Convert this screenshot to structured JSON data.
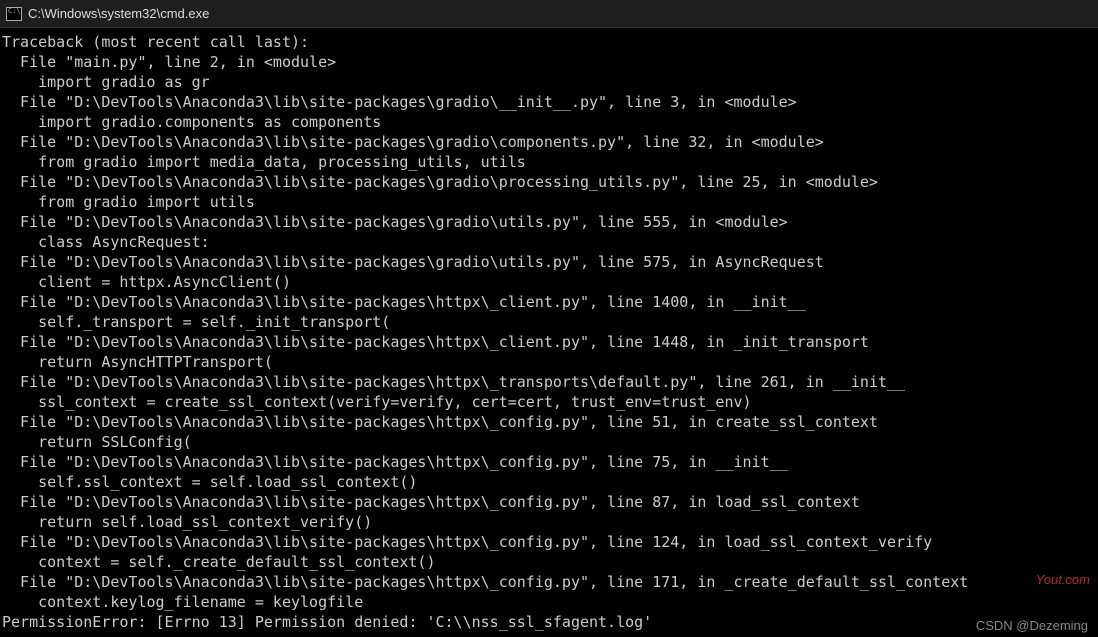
{
  "window": {
    "title": "C:\\Windows\\system32\\cmd.exe"
  },
  "terminal": {
    "lines": [
      "Traceback (most recent call last):",
      "  File \"main.py\", line 2, in <module>",
      "    import gradio as gr",
      "  File \"D:\\DevTools\\Anaconda3\\lib\\site-packages\\gradio\\__init__.py\", line 3, in <module>",
      "    import gradio.components as components",
      "  File \"D:\\DevTools\\Anaconda3\\lib\\site-packages\\gradio\\components.py\", line 32, in <module>",
      "    from gradio import media_data, processing_utils, utils",
      "  File \"D:\\DevTools\\Anaconda3\\lib\\site-packages\\gradio\\processing_utils.py\", line 25, in <module>",
      "    from gradio import utils",
      "  File \"D:\\DevTools\\Anaconda3\\lib\\site-packages\\gradio\\utils.py\", line 555, in <module>",
      "    class AsyncRequest:",
      "  File \"D:\\DevTools\\Anaconda3\\lib\\site-packages\\gradio\\utils.py\", line 575, in AsyncRequest",
      "    client = httpx.AsyncClient()",
      "  File \"D:\\DevTools\\Anaconda3\\lib\\site-packages\\httpx\\_client.py\", line 1400, in __init__",
      "    self._transport = self._init_transport(",
      "  File \"D:\\DevTools\\Anaconda3\\lib\\site-packages\\httpx\\_client.py\", line 1448, in _init_transport",
      "    return AsyncHTTPTransport(",
      "  File \"D:\\DevTools\\Anaconda3\\lib\\site-packages\\httpx\\_transports\\default.py\", line 261, in __init__",
      "    ssl_context = create_ssl_context(verify=verify, cert=cert, trust_env=trust_env)",
      "  File \"D:\\DevTools\\Anaconda3\\lib\\site-packages\\httpx\\_config.py\", line 51, in create_ssl_context",
      "    return SSLConfig(",
      "  File \"D:\\DevTools\\Anaconda3\\lib\\site-packages\\httpx\\_config.py\", line 75, in __init__",
      "    self.ssl_context = self.load_ssl_context()",
      "  File \"D:\\DevTools\\Anaconda3\\lib\\site-packages\\httpx\\_config.py\", line 87, in load_ssl_context",
      "    return self.load_ssl_context_verify()",
      "  File \"D:\\DevTools\\Anaconda3\\lib\\site-packages\\httpx\\_config.py\", line 124, in load_ssl_context_verify",
      "    context = self._create_default_ssl_context()",
      "  File \"D:\\DevTools\\Anaconda3\\lib\\site-packages\\httpx\\_config.py\", line 171, in _create_default_ssl_context",
      "    context.keylog_filename = keylogfile",
      "PermissionError: [Errno 13] Permission denied: 'C:\\\\nss_ssl_sfagent.log'"
    ]
  },
  "watermarks": {
    "right": "Yout.com",
    "bottom": "CSDN @Dezeming"
  }
}
